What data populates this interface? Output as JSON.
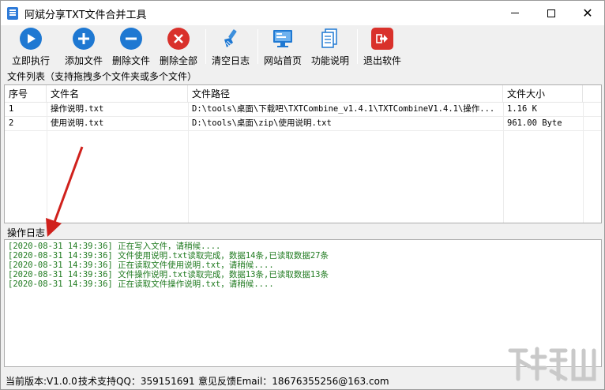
{
  "window": {
    "title": "阿斌分享TXT文件合并工具"
  },
  "toolbar": {
    "buttons": [
      {
        "label": "立即执行",
        "icon": "play-icon",
        "color": "#1e78d2"
      },
      {
        "label": "添加文件",
        "icon": "plus-icon",
        "color": "#1e78d2"
      },
      {
        "label": "删除文件",
        "icon": "minus-icon",
        "color": "#1e78d2"
      },
      {
        "label": "删除全部",
        "icon": "close-icon",
        "color": "#d9312b"
      },
      {
        "label": "清空日志",
        "icon": "broom-icon",
        "color": "#1e78d2"
      },
      {
        "label": "网站首页",
        "icon": "monitor-icon",
        "color": "#1e78d2"
      },
      {
        "label": "功能说明",
        "icon": "document-icon",
        "color": "#1e78d2"
      },
      {
        "label": "退出软件",
        "icon": "exit-icon",
        "color": "#d9312b"
      }
    ]
  },
  "file_list": {
    "section_label": "文件列表（支持拖拽多个文件夹或多个文件）",
    "columns": [
      "序号",
      "文件名",
      "文件路径",
      "文件大小"
    ],
    "rows": [
      [
        "1",
        "操作说明.txt",
        "D:\\tools\\桌面\\下载吧\\TXTCombine_v1.4.1\\TXTCombineV1.4.1\\操作...",
        "1.16 K"
      ],
      [
        "2",
        "使用说明.txt",
        "D:\\tools\\桌面\\zip\\使用说明.txt",
        "961.00 Byte"
      ]
    ]
  },
  "log": {
    "section_label": "操作日志",
    "lines": [
      "[2020-08-31 14:39:36] 正在写入文件，请稍候....",
      "[2020-08-31 14:39:36] 文件使用说明.txt读取完成，数据14条,已读取数据27条",
      "[2020-08-31 14:39:36] 正在读取文件使用说明.txt，请稍候....",
      "[2020-08-31 14:39:36] 文件操作说明.txt读取完成，数据13条,已读取数据13条",
      "[2020-08-31 14:39:36] 正在读取文件操作说明.txt，请稍候...."
    ],
    "color": "#1f7a1f"
  },
  "statusbar": {
    "version": "当前版本:V1.0.0",
    "support": "技术支持QQ：359151691",
    "feedback": "意见反馈Email：18676355256@163.com"
  },
  "annotation": {
    "arrow_color": "#d0211c"
  }
}
